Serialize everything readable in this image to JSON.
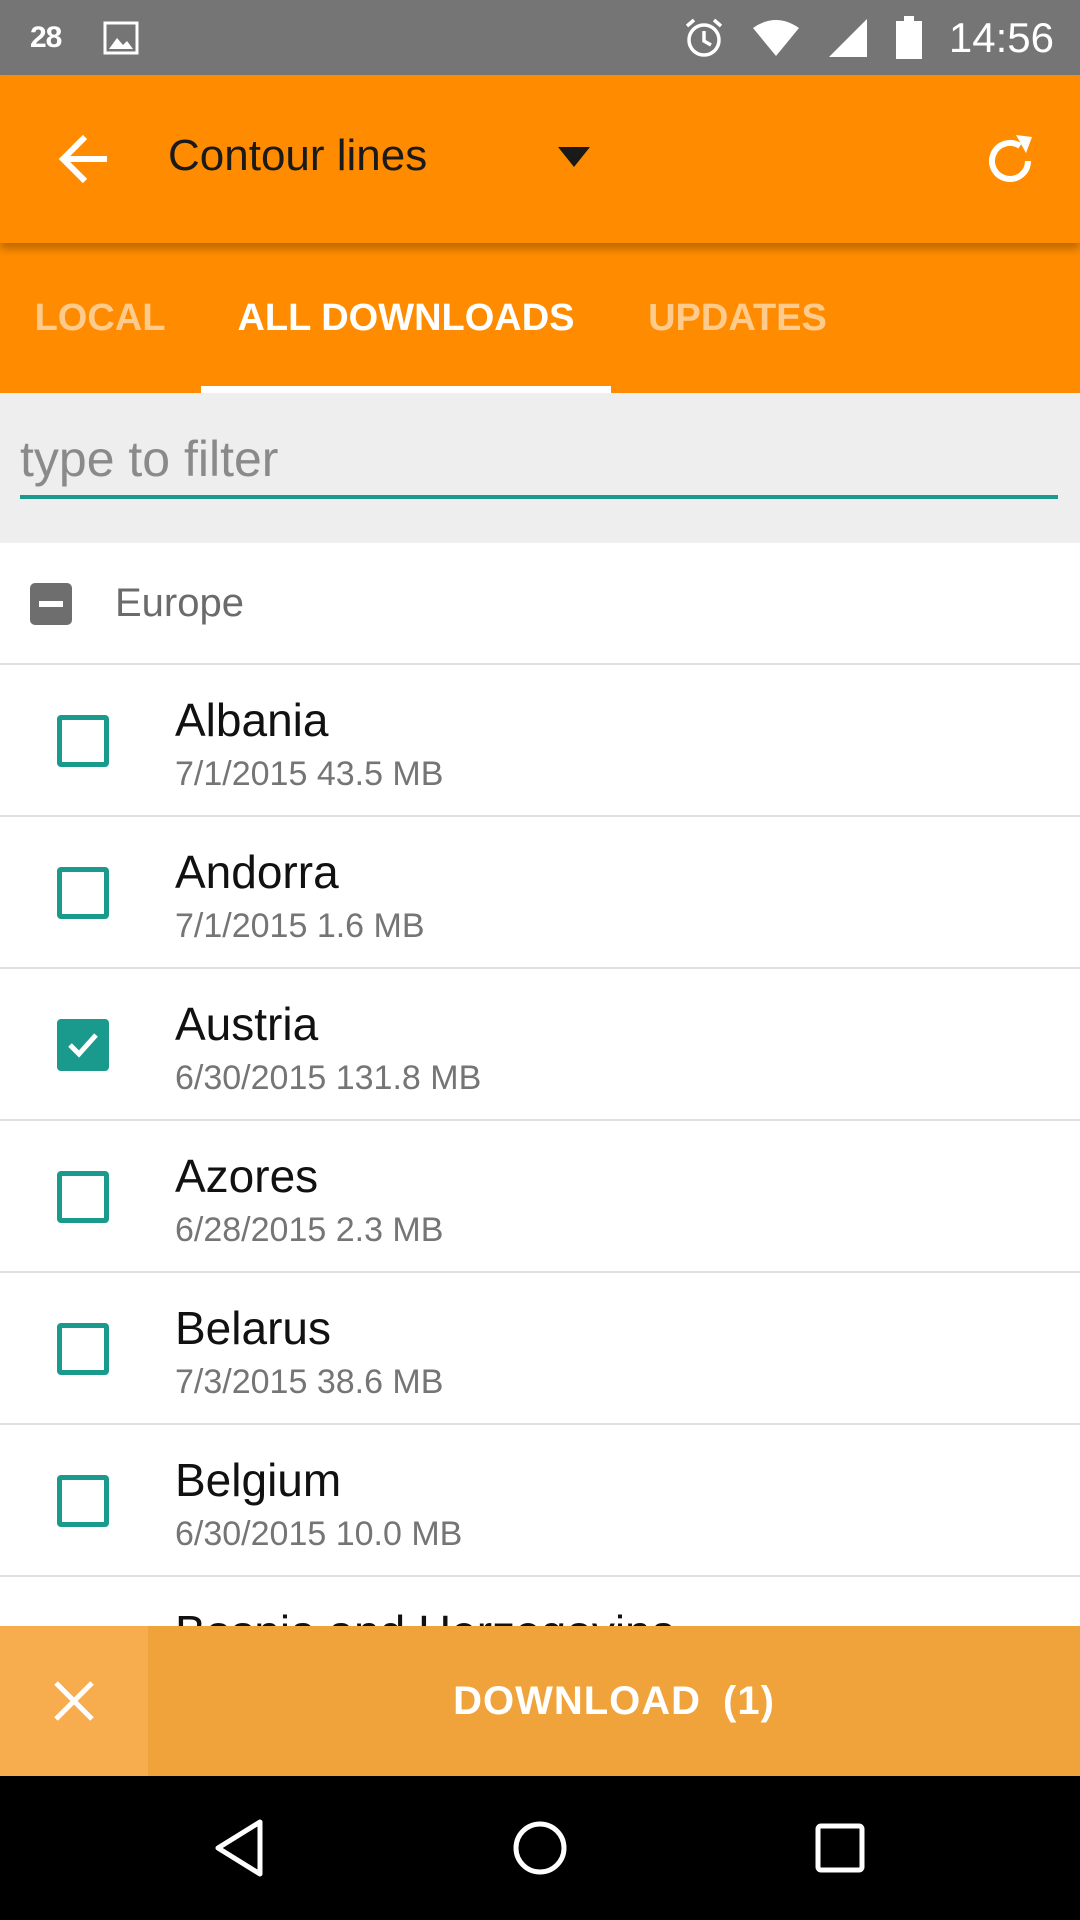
{
  "status_bar": {
    "notification_number": "28",
    "time": "14:56"
  },
  "toolbar": {
    "title": "Contour lines",
    "back_icon": "arrow-left-icon",
    "dropdown_icon": "triangle-down-icon",
    "refresh_icon": "refresh-icon"
  },
  "tabs": [
    {
      "label": "LOCAL",
      "active": false
    },
    {
      "label": "ALL DOWNLOADS",
      "active": true
    },
    {
      "label": "UPDATES",
      "active": false
    }
  ],
  "filter": {
    "placeholder": "type to filter",
    "value": ""
  },
  "group": {
    "label": "Europe",
    "state": "partial"
  },
  "items": [
    {
      "name": "Albania",
      "date": "7/1/2015",
      "size": "43.5 MB",
      "checked": false
    },
    {
      "name": "Andorra",
      "date": "7/1/2015",
      "size": "1.6 MB",
      "checked": false
    },
    {
      "name": "Austria",
      "date": "6/30/2015",
      "size": "131.8 MB",
      "checked": true
    },
    {
      "name": "Azores",
      "date": "6/28/2015",
      "size": "2.3 MB",
      "checked": false
    },
    {
      "name": "Belarus",
      "date": "7/3/2015",
      "size": "38.6 MB",
      "checked": false
    },
    {
      "name": "Belgium",
      "date": "6/30/2015",
      "size": "10.0 MB",
      "checked": false
    },
    {
      "name": "Bosnia and Herzegovina"
    }
  ],
  "action_bar": {
    "download_label": "DOWNLOAD",
    "download_count": "(1)"
  },
  "colors": {
    "accent": "#ff8c00",
    "teal": "#1a9a8c",
    "action_bar": "#f0a33b"
  }
}
